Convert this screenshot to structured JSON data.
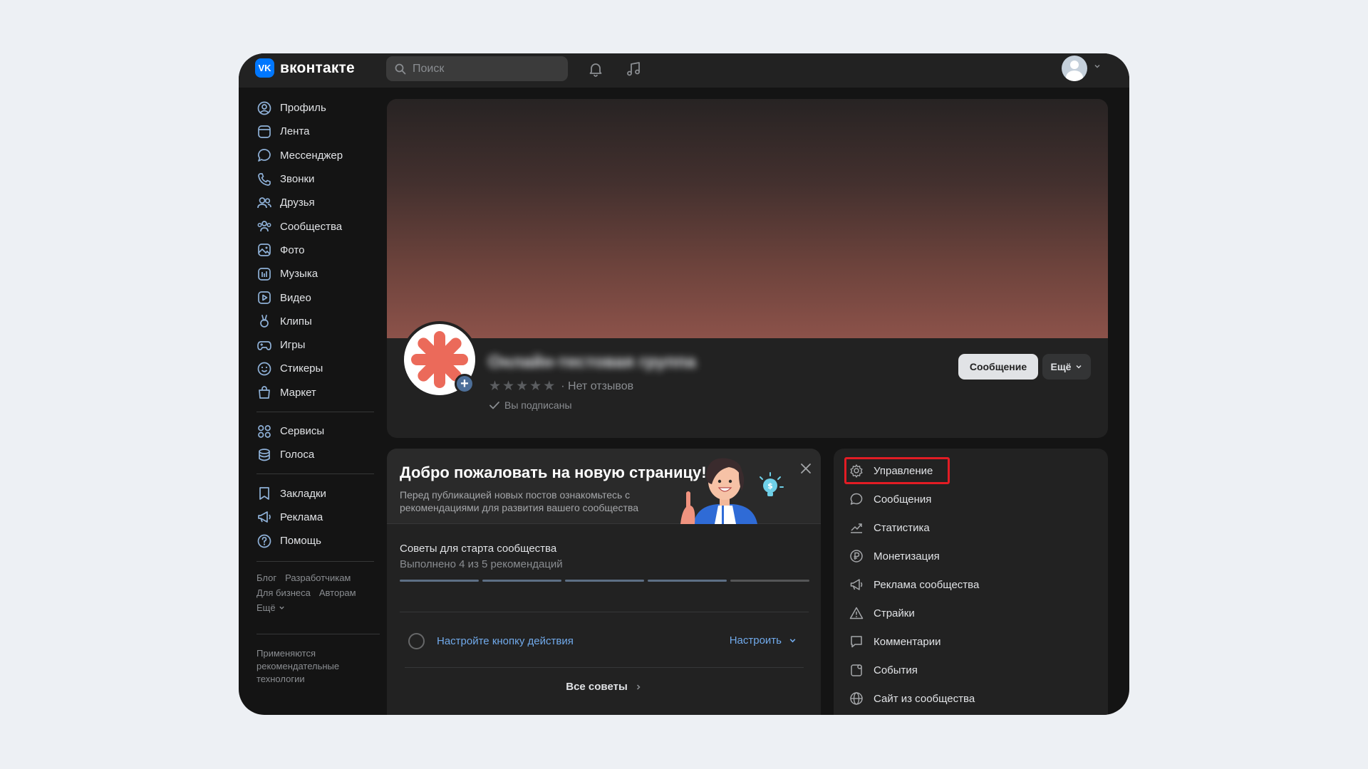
{
  "header": {
    "logo_mark": "VK",
    "logo_text": "вконтакте",
    "search_placeholder": "Поиск"
  },
  "sidebar": {
    "items": [
      {
        "label": "Профиль",
        "icon": "profile-icon"
      },
      {
        "label": "Лента",
        "icon": "feed-icon"
      },
      {
        "label": "Мессенджер",
        "icon": "messenger-icon"
      },
      {
        "label": "Звонки",
        "icon": "phone-icon"
      },
      {
        "label": "Друзья",
        "icon": "friends-icon"
      },
      {
        "label": "Сообщества",
        "icon": "communities-icon"
      },
      {
        "label": "Фото",
        "icon": "photo-icon"
      },
      {
        "label": "Музыка",
        "icon": "music-icon"
      },
      {
        "label": "Видео",
        "icon": "video-icon"
      },
      {
        "label": "Клипы",
        "icon": "clips-icon"
      },
      {
        "label": "Игры",
        "icon": "gamepad-icon"
      },
      {
        "label": "Стикеры",
        "icon": "smile-icon"
      },
      {
        "label": "Маркет",
        "icon": "bag-icon"
      }
    ],
    "items2": [
      {
        "label": "Сервисы",
        "icon": "services-icon"
      },
      {
        "label": "Голоса",
        "icon": "coins-icon"
      }
    ],
    "items3": [
      {
        "label": "Закладки",
        "icon": "bookmark-icon"
      },
      {
        "label": "Реклама",
        "icon": "megaphone-icon"
      },
      {
        "label": "Помощь",
        "icon": "help-icon"
      }
    ],
    "footer_links": {
      "blog": "Блог",
      "developers": "Разработчикам",
      "business": "Для бизнеса",
      "authors": "Авторам",
      "more": "Ещё"
    },
    "footer_note": "Применяются рекомендательные технологии"
  },
  "community": {
    "name": "Онлайн-тестовая группа",
    "reviews_text": "· Нет отзывов",
    "rating_stars": 0,
    "subscribed_text": "Вы подписаны",
    "message_button": "Сообщение",
    "more_button": "Ещё"
  },
  "welcome": {
    "title": "Добро пожаловать на новую страницу!",
    "subtitle": "Перед публикацией новых постов ознакомьтесь с рекомендациями для развития вашего сообщества",
    "tips_title": "Советы для старта сообщества",
    "tips_progress": "Выполнено 4 из 5 рекомендаций",
    "progress_done": 4,
    "progress_total": 5,
    "task_label": "Настройте кнопку действия",
    "task_action": "Настроить",
    "all_tips": "Все советы"
  },
  "management": {
    "items": [
      {
        "label": "Управление",
        "icon": "gear-icon",
        "highlighted": true
      },
      {
        "label": "Сообщения",
        "icon": "chat-bubble-icon"
      },
      {
        "label": "Статистика",
        "icon": "stats-icon"
      },
      {
        "label": "Монетизация",
        "icon": "ruble-icon"
      },
      {
        "label": "Реклама сообщества",
        "icon": "megaphone-icon"
      },
      {
        "label": "Страйки",
        "icon": "warning-icon"
      },
      {
        "label": "Комментарии",
        "icon": "comment-icon"
      },
      {
        "label": "События",
        "icon": "event-icon"
      },
      {
        "label": "Сайт из сообщества",
        "icon": "globe-icon"
      }
    ]
  },
  "colors": {
    "accent": "#0077ff",
    "link": "#71aaeb",
    "highlight_border": "#e21c24",
    "background": "#141414",
    "card": "#222222"
  }
}
